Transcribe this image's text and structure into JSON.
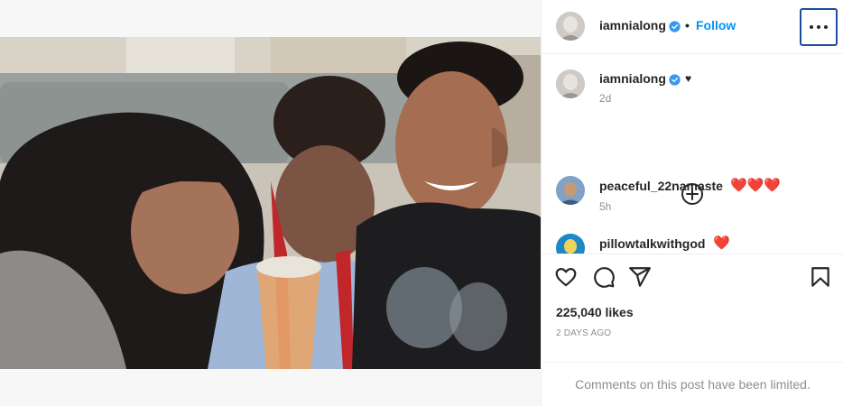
{
  "post": {
    "author": "iamnialong",
    "separator": "•",
    "follow_label": "Follow",
    "caption": "♥",
    "caption_time": "2d",
    "likes": "225,040 likes",
    "posted_ago": "2 DAYS AGO",
    "comments_limited": "Comments on this post have been limited."
  },
  "comments": [
    {
      "username": "peaceful_22namaste",
      "text": "❤️❤️❤️",
      "time": "5h"
    },
    {
      "username": "pillowtalkwithgod",
      "text": "❤️"
    }
  ],
  "icons": {
    "verified": "verified-badge-icon",
    "more": "more-options-icon",
    "load_more": "load-more-comments-icon",
    "like": "heart-icon",
    "comment": "comment-icon",
    "share": "share-icon",
    "save": "bookmark-icon"
  },
  "colors": {
    "accent": "#0095f6",
    "text": "#262626",
    "muted": "#8e8e8e",
    "heart": "#e0245e",
    "focus_ring": "#1c4e9f"
  }
}
